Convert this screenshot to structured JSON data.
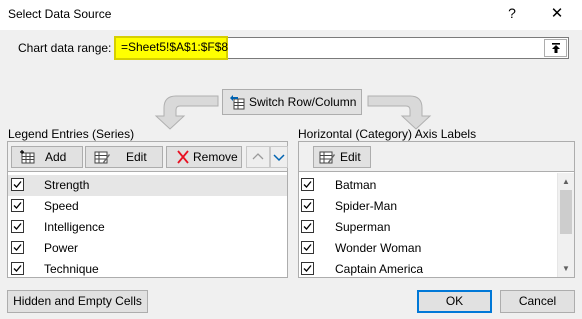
{
  "window": {
    "title": "Select Data Source",
    "help_glyph": "?",
    "close_glyph": "✕"
  },
  "range": {
    "label": "Chart data range:",
    "value": "=Sheet5!$A$1:$F$8"
  },
  "switch_button": {
    "label": "Switch Row/Column"
  },
  "legend": {
    "heading": "Legend Entries (Series)",
    "add_label": "Add",
    "edit_label": "Edit",
    "remove_label": "Remove",
    "items": [
      {
        "label": "Strength",
        "checked": true,
        "selected": true
      },
      {
        "label": "Speed",
        "checked": true,
        "selected": false
      },
      {
        "label": "Intelligence",
        "checked": true,
        "selected": false
      },
      {
        "label": "Power",
        "checked": true,
        "selected": false
      },
      {
        "label": "Technique",
        "checked": true,
        "selected": false
      }
    ]
  },
  "axis": {
    "heading": "Horizontal (Category) Axis Labels",
    "edit_label": "Edit",
    "items": [
      {
        "label": "Batman",
        "checked": true
      },
      {
        "label": "Spider-Man",
        "checked": true
      },
      {
        "label": "Superman",
        "checked": true
      },
      {
        "label": "Wonder Woman",
        "checked": true
      },
      {
        "label": "Captain America",
        "checked": true
      }
    ]
  },
  "footer": {
    "hidden_cells_label": "Hidden and Empty Cells",
    "ok_label": "OK",
    "cancel_label": "Cancel"
  },
  "colors": {
    "highlight": "#ffff00",
    "remove_icon": "#e81123",
    "arrow_up_icon": "#0063b1",
    "default_button_border": "#0078d7"
  }
}
